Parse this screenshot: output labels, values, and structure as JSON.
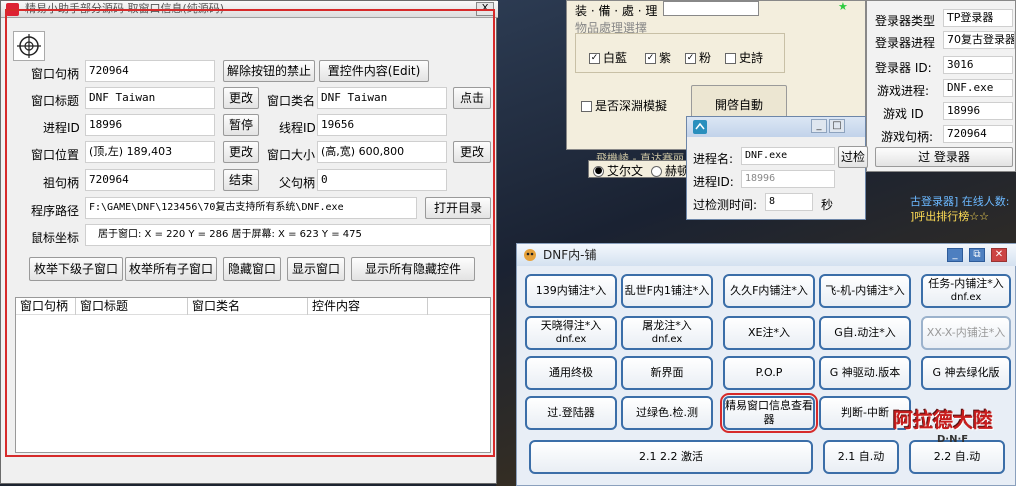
{
  "spy_window": {
    "title": "精易小助手部分源码 取窗口信息(纯源码)",
    "close_label": "X",
    "labels": {
      "window_handle": "窗口句柄",
      "window_title": "窗口标题",
      "process_id": "进程ID",
      "window_position": "窗口位置",
      "grand_handle": "祖句柄",
      "program_path": "程序路径",
      "mouse_coords": "鼠标坐标",
      "window_class": "窗口类名",
      "thread_id": "线程ID",
      "window_size": "窗口大小",
      "parent_handle": "父句柄"
    },
    "values": {
      "window_handle": "720964",
      "window_title": "DNF Taiwan",
      "process_id": "18996",
      "window_position": "(顶,左) 189,403",
      "grand_handle": "720964",
      "program_path": "F:\\GAME\\DNF\\123456\\70复古支持所有系统\\DNF.exe",
      "mouse_coords": "居于窗口: X = 220  Y = 286   居于屏幕: X = 623  Y = 475",
      "window_class": "DNF Taiwan",
      "thread_id": "19656",
      "window_size": "(高,宽) 600,800",
      "parent_handle": "0"
    },
    "buttons": {
      "unlock": "解除按钮的禁止",
      "set_content": "置控件内容(Edit)",
      "change_title": "更改",
      "click": "点击",
      "pause": "暂停",
      "change_position": "更改",
      "change_size": "更改",
      "end": "结束",
      "open_dir": "打开目录",
      "enum_children": "枚举下级子窗口",
      "enum_all": "枚举所有子窗口",
      "hide": "隐藏窗口",
      "show": "显示窗口",
      "show_all": "显示所有隐藏控件"
    },
    "list_headers": [
      "窗口句柄",
      "窗口标题",
      "窗口类名",
      "控件内容"
    ]
  },
  "panel_items": {
    "top_label": "装 · 備 · 處 · 理",
    "group_title": "物品處理選擇",
    "checks": [
      {
        "label": "白藍",
        "checked": true
      },
      {
        "label": "紫",
        "checked": true
      },
      {
        "label": "粉",
        "checked": true
      },
      {
        "label": "史詩",
        "checked": false
      }
    ],
    "deep_sea": "是否深淵模擬",
    "auto_close": "開啓自動",
    "region_label": "飛機崚 - 直达赛丽",
    "radio_elvenmark": "艾尔文",
    "radio_hendon": "赫顿"
  },
  "login_panel": {
    "type_label": "登录器类型",
    "type_value": "TP登录器",
    "process_label": "登录器进程",
    "process_value": "70复古登录器",
    "id_label": "登录器 ID:",
    "id_value": "3016",
    "game_process_label": "游戏进程:",
    "game_process_value": "DNF.exe",
    "game_id_label": "游戏 ID",
    "game_id_value": "18996",
    "game_handle_label": "游戏句柄:",
    "game_handle_value": "720964",
    "bypass_button": "过 登录器",
    "scroll_text": "古登录器] 在线人数:",
    "rank_text": "]呼出排行榜☆☆"
  },
  "small_dialog": {
    "process_name_label": "进程名:",
    "process_name_value": "DNF.exe",
    "process_id_label": "进程ID:",
    "process_id_value": "18996",
    "interval_label": "过检测时间:",
    "interval_value": "8",
    "unit": "秒",
    "side_button": "过检"
  },
  "dnf_tool": {
    "title": "DNF内-铺",
    "buttons": [
      {
        "label": "139内铺注*入",
        "sub": ""
      },
      {
        "label": "乱世F内1铺注*入",
        "sub": ""
      },
      {
        "label": "久久F内铺注*入",
        "sub": ""
      },
      {
        "label": "飞-机-内铺注*入",
        "sub": ""
      },
      {
        "label": "任务-内铺注*入",
        "sub": "dnf.ex"
      },
      {
        "label": "天晓得注*入",
        "sub": "dnf.ex"
      },
      {
        "label": "屠龙注*入",
        "sub": "dnf.ex"
      },
      {
        "label": "XE注*入",
        "sub": ""
      },
      {
        "label": "G自.动注*入",
        "sub": ""
      },
      {
        "label": "XX-X-内铺注*入",
        "sub": ""
      },
      {
        "label": "通用终极",
        "sub": ""
      },
      {
        "label": "新界面",
        "sub": ""
      },
      {
        "label": "P.O.P",
        "sub": ""
      },
      {
        "label": "G 神驱动.版本",
        "sub": ""
      },
      {
        "label": "G 神去绿化版",
        "sub": ""
      },
      {
        "label": "过.登陆器",
        "sub": ""
      },
      {
        "label": "过绿色.检.测",
        "sub": ""
      },
      {
        "label": "精易窗口信息查看器",
        "sub": ""
      },
      {
        "label": "判断-中断",
        "sub": ""
      },
      {
        "label": "2.1 2.2 激活",
        "sub": ""
      },
      {
        "label": "2.1 自.动",
        "sub": ""
      },
      {
        "label": "2.2 自.动",
        "sub": ""
      }
    ],
    "logo_text": "阿拉德大陸",
    "logo_sub": "D·N·F"
  },
  "colors": {
    "highlight_red": "#d62a2a",
    "button_border": "#3b6ea8"
  }
}
